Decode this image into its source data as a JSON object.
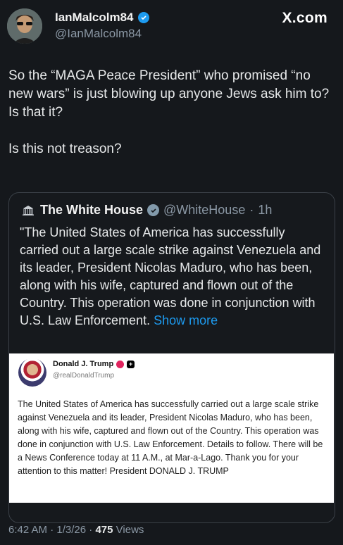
{
  "post": {
    "author_name": "IanMalcolm84",
    "author_handle": "@IanMalcolm84",
    "site_logo": "X.com",
    "text": "So the “MAGA Peace President” who promised “no new wars” is just blowing up anyone Jews ask him to? Is that it?\n\nIs this not treason?",
    "time": "6:42 AM",
    "date": "1/3/26",
    "views_count": "475",
    "views_label": "Views",
    "separator": "·"
  },
  "quote": {
    "author_name": "The White House",
    "author_handle": "@WhiteHouse",
    "age": "1h",
    "text": "\"The United States of America has successfully carried out a large scale strike against Venezuela and its leader, President Nicolas Maduro, who has been, along with his wife, captured and flown out of the Country. This operation was done in conjunction with U.S. Law Enforcement.",
    "show_more": "Show more"
  },
  "card": {
    "author_name": "Donald J. Trump",
    "author_handle": "@realDonaldTrump",
    "text": "The United States of America has successfully carried out a large scale strike against Venezuela and its leader, President Nicolas Maduro, who has been, along with his wife, captured and flown out of the Country. This operation was done in conjunction with U.S. Law Enforcement. Details to follow. There will be a News Conference today at 11 A.M., at Mar-a-Lago. Thank you for your attention to this matter! President DONALD J. TRUMP"
  },
  "colors": {
    "background": "#15181c",
    "link": "#1d9bf0",
    "verified": "#1d9bf0",
    "gov_badge": "#829aab",
    "muted": "#8b98a5"
  },
  "icons": [
    "verified-badge-icon",
    "x-logo",
    "white-house-logo-icon",
    "government-badge-icon",
    "pink-verified-icon",
    "plus-badge-icon"
  ]
}
